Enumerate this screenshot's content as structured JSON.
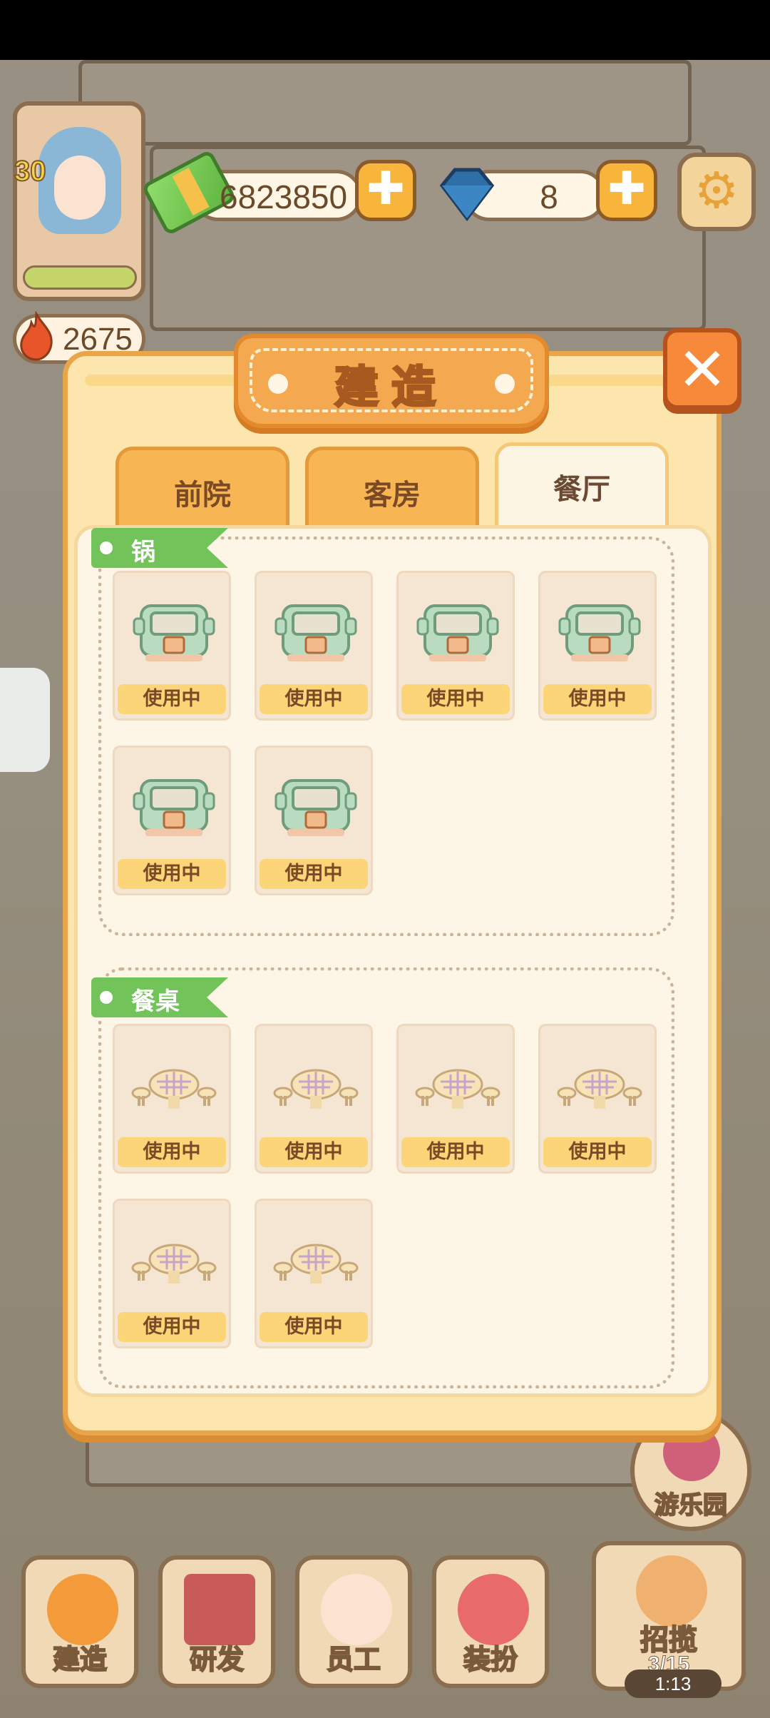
{
  "hud": {
    "level": "30",
    "money": "6823850",
    "gems": "8",
    "energy": "2675",
    "plus_symbol": "✚",
    "gear_symbol": "⚙"
  },
  "nav": {
    "build": "建造",
    "research": "研发",
    "staff": "员工",
    "dress": "装扮",
    "recruit": "招揽",
    "recruit_count": "3/15",
    "recruit_timer": "1:13",
    "park": "游乐园"
  },
  "dialog": {
    "title": "建造",
    "close_symbol": "✕",
    "tabs": [
      {
        "label": "前院",
        "active": false
      },
      {
        "label": "客房",
        "active": false
      },
      {
        "label": "餐厅",
        "active": true
      }
    ],
    "sections": [
      {
        "title": "锅",
        "items": [
          {
            "icon": "pot-icon",
            "status": "使用中"
          },
          {
            "icon": "pot-icon",
            "status": "使用中"
          },
          {
            "icon": "pot-icon",
            "status": "使用中"
          },
          {
            "icon": "pot-icon",
            "status": "使用中"
          },
          {
            "icon": "pot-icon",
            "status": "使用中"
          },
          {
            "icon": "pot-icon",
            "status": "使用中"
          }
        ]
      },
      {
        "title": "餐桌",
        "items": [
          {
            "icon": "dining-table-icon",
            "status": "使用中"
          },
          {
            "icon": "dining-table-icon",
            "status": "使用中"
          },
          {
            "icon": "dining-table-icon",
            "status": "使用中"
          },
          {
            "icon": "dining-table-icon",
            "status": "使用中"
          },
          {
            "icon": "dining-table-icon",
            "status": "使用中"
          },
          {
            "icon": "dining-table-icon",
            "status": "使用中"
          }
        ]
      }
    ]
  },
  "colors": {
    "panel_bg": "#fde6ad",
    "tab_inactive": "#f8b553",
    "tab_active": "#fdf5e4",
    "ribbon_green": "#71c35a",
    "status_yellow": "#fbd578",
    "close_orange": "#f78a3a"
  }
}
